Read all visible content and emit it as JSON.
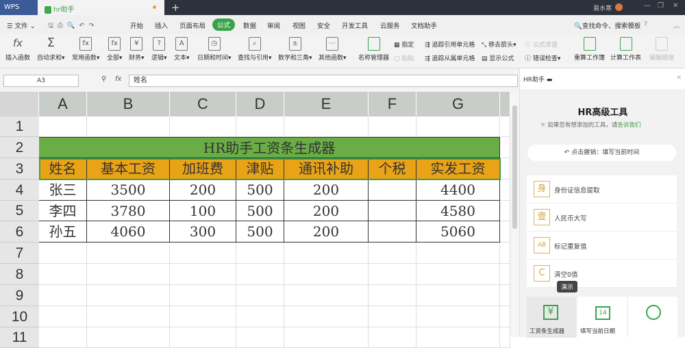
{
  "titlebar": {
    "app": "WPS",
    "doc_tab": "hr助手",
    "user": "易水寒",
    "new_tab": "+"
  },
  "menu": [
    "文件",
    "开始",
    "插入",
    "页面布局",
    "公式",
    "数据",
    "审阅",
    "视图",
    "安全",
    "开发工具",
    "云服务",
    "文档助手"
  ],
  "active_menu": "公式",
  "search": "查找命令、搜索模板",
  "toolbar": {
    "big": [
      "插入函数",
      "自动求和",
      "常用函数",
      "全部",
      "财务",
      "逻辑",
      "文本",
      "日期和时间",
      "查找与引用",
      "数学和三角",
      "其他函数",
      "名称管理器"
    ],
    "small": [
      "指定",
      "粘贴",
      "追踪引用单元格",
      "追踪从属单元格",
      "移去箭头",
      "显示公式",
      "公式求值",
      "错误检查"
    ],
    "right": [
      "重算工作簿",
      "计算工作表",
      "编辑链接"
    ]
  },
  "formula": {
    "cell_ref": "A3",
    "fx": "fx",
    "value": "姓名"
  },
  "columns": [
    "A",
    "B",
    "C",
    "D",
    "E",
    "F",
    "G"
  ],
  "rows": [
    "1",
    "2",
    "3",
    "4",
    "5",
    "6",
    "7",
    "8",
    "9",
    "10",
    "11"
  ],
  "sheet": {
    "title": "HR助手工资条生成器",
    "headers": [
      "姓名",
      "基本工资",
      "加班费",
      "津贴",
      "通讯补助",
      "个税",
      "实发工资"
    ],
    "data": [
      [
        "张三",
        "3500",
        "200",
        "500",
        "200",
        "",
        "4400"
      ],
      [
        "李四",
        "3780",
        "100",
        "500",
        "200",
        "",
        "4580"
      ],
      [
        "孙五",
        "4060",
        "300",
        "500",
        "200",
        "",
        "5060"
      ]
    ]
  },
  "panel": {
    "header": "HR助手",
    "title": "HR高级工具",
    "hint": "如果您有想添加的工具，请",
    "hint_link": "告诉我们",
    "undo": "点击撤销：填写当前时间",
    "items": [
      {
        "icon": "身",
        "label": "身份证信息提取"
      },
      {
        "icon": "壹",
        "label": "人民币大写"
      },
      {
        "icon": "AB",
        "label": "标记重复值"
      },
      {
        "icon": "C",
        "label": "清空0值"
      }
    ],
    "tooltip": "演示",
    "tiles": [
      "工资条生成器",
      "填写当前日期"
    ],
    "calendar_day": "14"
  },
  "colors": {
    "title_green": "#6aac45",
    "header_orange": "#e8a317",
    "accent": "#3aa34a"
  }
}
